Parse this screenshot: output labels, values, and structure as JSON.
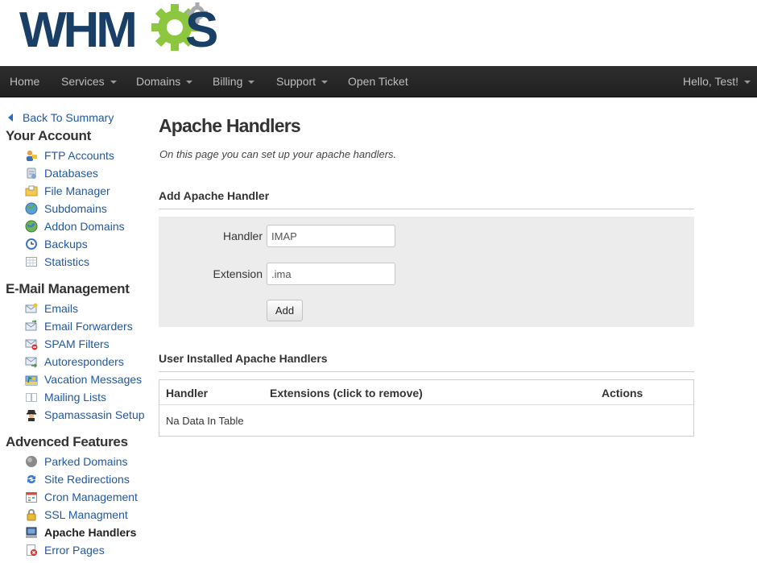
{
  "brand": {
    "logo_text": "WHMCS",
    "colors": {
      "wordmark": "#1a3f66",
      "gear": "#8dc63f"
    }
  },
  "navbar": {
    "items": [
      {
        "label": "Home",
        "dropdown": false
      },
      {
        "label": "Services",
        "dropdown": true
      },
      {
        "label": "Domains",
        "dropdown": true
      },
      {
        "label": "Billing",
        "dropdown": true
      },
      {
        "label": "Support",
        "dropdown": true
      },
      {
        "label": "Open Ticket",
        "dropdown": false
      }
    ],
    "user_menu": "Hello, Test!"
  },
  "sidebar": {
    "back_link": "Back To Summary",
    "sections": [
      {
        "title": "Your Account",
        "items": [
          {
            "label": "FTP Accounts",
            "icon": "ftp-user-icon"
          },
          {
            "label": "Databases",
            "icon": "database-icon"
          },
          {
            "label": "File Manager",
            "icon": "folder-icon"
          },
          {
            "label": "Subdomains",
            "icon": "globe-icon"
          },
          {
            "label": "Addon Domains",
            "icon": "globe-add-icon"
          },
          {
            "label": "Backups",
            "icon": "clock-icon"
          },
          {
            "label": "Statistics",
            "icon": "stats-grid-icon"
          }
        ]
      },
      {
        "title": "E-Mail Management",
        "items": [
          {
            "label": "Emails",
            "icon": "envelope-star-icon"
          },
          {
            "label": "Email Forwarders",
            "icon": "envelope-forward-icon"
          },
          {
            "label": "SPAM Filters",
            "icon": "envelope-block-icon"
          },
          {
            "label": "Autoresponders",
            "icon": "envelope-arrow-icon"
          },
          {
            "label": "Vacation Messages",
            "icon": "beach-icon"
          },
          {
            "label": "Mailing Lists",
            "icon": "list-icon"
          },
          {
            "label": "Spamassasin Setup",
            "icon": "spy-icon"
          }
        ]
      },
      {
        "title": "Advenced Features",
        "items": [
          {
            "label": "Parked Domains",
            "icon": "gray-circle-icon"
          },
          {
            "label": "Site Redirections",
            "icon": "redirect-arrows-icon"
          },
          {
            "label": "Cron Management",
            "icon": "calendar-icon"
          },
          {
            "label": "SSL Managment",
            "icon": "padlock-icon"
          },
          {
            "label": "Apache Handlers",
            "icon": "computer-icon",
            "active": true
          },
          {
            "label": "Error Pages",
            "icon": "error-page-icon"
          }
        ]
      }
    ]
  },
  "main": {
    "title": "Apache Handlers",
    "description": "On this page you can set up your apache handlers.",
    "add_section": {
      "title": "Add Apache Handler",
      "handler_label": "Handler",
      "handler_value": "IMAP",
      "extension_label": "Extension",
      "extension_value": ".ima",
      "add_button": "Add"
    },
    "installed_section": {
      "title": "User Installed Apache Handlers",
      "columns": [
        "Handler",
        "Extensions (click to remove)",
        "Actions"
      ],
      "empty_text": "Na Data In Table"
    }
  }
}
